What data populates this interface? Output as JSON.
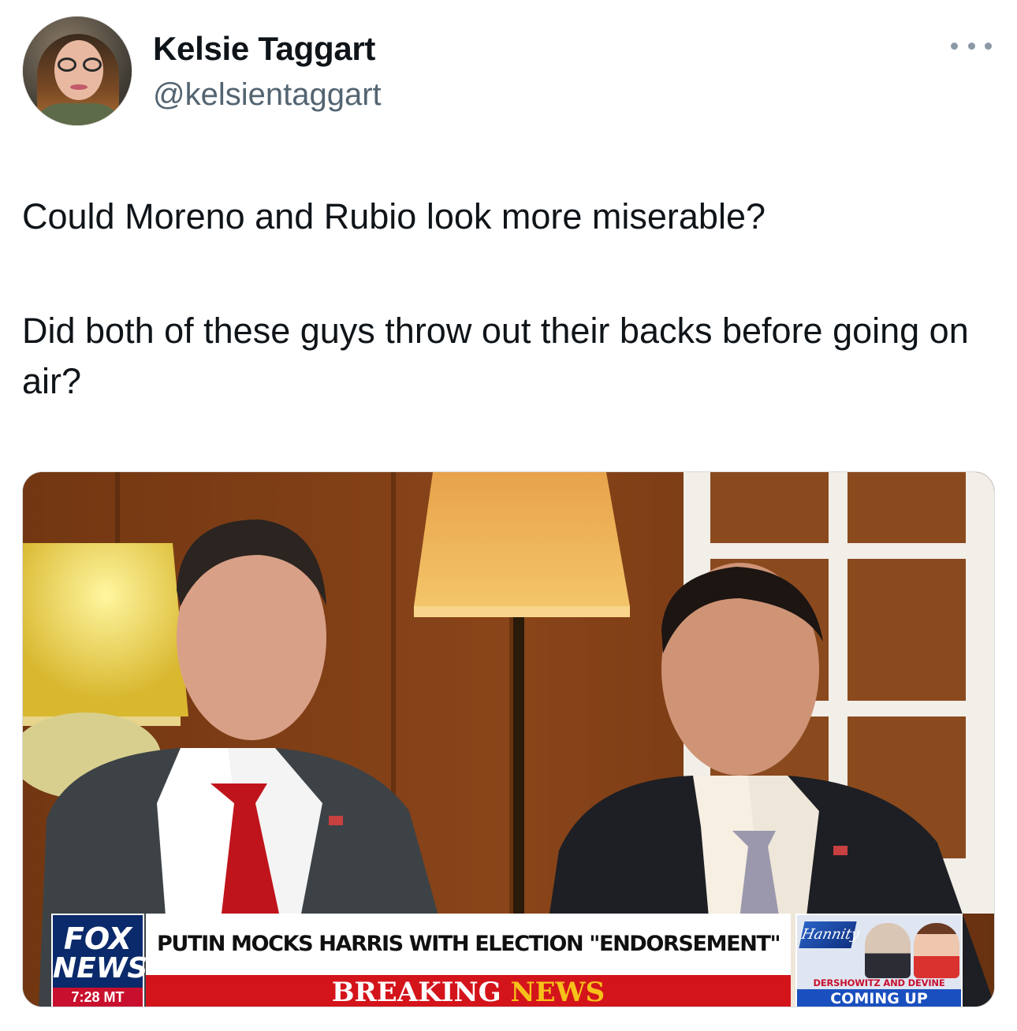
{
  "tweet": {
    "author": {
      "name": "Kelsie Taggart",
      "handle": "@kelsientaggart"
    },
    "text": [
      "Could Moreno and Rubio look more miserable?",
      "Did both of these guys throw out their backs before going on air?"
    ]
  },
  "media": {
    "lower_third": {
      "logo_top": "FOX",
      "logo_bottom": "NEWS",
      "time": "7:28 MT",
      "headline": "PUTIN MOCKS HARRIS WITH ELECTION \"ENDORSEMENT\"",
      "banner_word1": "BREAKING",
      "banner_word2": "NEWS",
      "promo_show": "Hannity",
      "promo_caption": "DERSHOWITZ AND DEVINE",
      "promo_status": "COMING UP"
    }
  },
  "colors": {
    "handle": "#536471",
    "breaking_red": "#d4141b",
    "fox_blue": "#0b2a6b"
  },
  "icons": {
    "more": "more-horizontal-icon"
  }
}
